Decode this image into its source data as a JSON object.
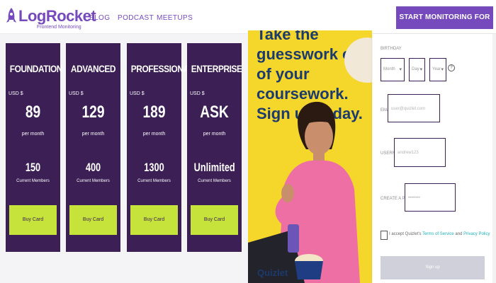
{
  "header": {
    "logo_text": "LogRocket",
    "logo_subtext": "Frontend Monitoring",
    "nav": [
      "BLOG",
      "PODCAST",
      "MEETUPS"
    ],
    "cta": "START MONITORING FOR FREE"
  },
  "pricing": {
    "plans": [
      {
        "name": "FOUNDATION",
        "currency": "USD $",
        "price": "89",
        "period": "per month",
        "count": "150",
        "count_label": "Current Members",
        "button": "Buy Card"
      },
      {
        "name": "ADVANCED",
        "currency": "USD $",
        "price": "129",
        "period": "per month",
        "count": "400",
        "count_label": "Current Members",
        "button": "Buy Card"
      },
      {
        "name": "PROFESSIONAL",
        "currency": "USD $",
        "price": "189",
        "period": "per month",
        "count": "1300",
        "count_label": "Current Members",
        "button": "Buy Card"
      },
      {
        "name": "ENTERPRISE",
        "currency": "USD $",
        "price": "ASK",
        "period": "per month",
        "count": "Unlimited",
        "count_label": "Current Members",
        "button": "Buy Card"
      }
    ]
  },
  "promo": {
    "text": "Take the guesswork out of your coursework. Sign up today.",
    "brand": "Quizlet"
  },
  "form": {
    "birthday_label": "BIRTHDAY",
    "month": "Month",
    "day": "Day",
    "year": "Year",
    "email_label": "EMAIL",
    "email_placeholder": "user@quizlet.com",
    "username_label": "USERNAME",
    "username_placeholder": "andrew123",
    "password_label": "CREATE A PASSWORD",
    "password_placeholder": "••••••••",
    "terms_prefix": "I accept Quizlet's ",
    "terms_link": "Terms of Service",
    "terms_and": " and ",
    "privacy_link": "Privacy Policy",
    "submit": "Sign up"
  },
  "colors": {
    "brand": "#764abc",
    "card_bg": "#3b1f55",
    "card_button": "#c5e33a",
    "promo_bg": "#f5d62b",
    "promo_text": "#1b3a6d",
    "link": "#1eb1b5"
  }
}
